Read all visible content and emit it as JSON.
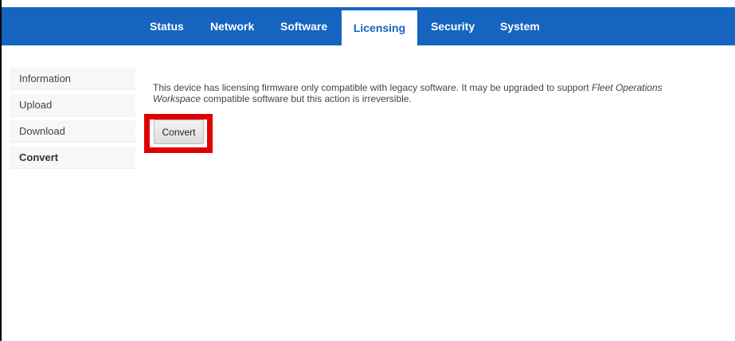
{
  "nav": {
    "tabs": [
      {
        "label": "Status"
      },
      {
        "label": "Network"
      },
      {
        "label": "Software"
      },
      {
        "label": "Licensing"
      },
      {
        "label": "Security"
      },
      {
        "label": "System"
      }
    ],
    "active_tab": "Licensing",
    "bar_color": "#1565c0"
  },
  "sidebar": {
    "items": [
      {
        "label": "Information"
      },
      {
        "label": "Upload"
      },
      {
        "label": "Download"
      },
      {
        "label": "Convert"
      }
    ],
    "active_item": "Convert"
  },
  "main": {
    "message_prefix": "This device has licensing firmware only compatible with legacy software. It may be upgraded to support ",
    "message_emphasis": "Fleet Operations Workspace",
    "message_suffix": " compatible software but this action is irreversible.",
    "convert_button_label": "Convert",
    "highlight_color": "#e00000"
  }
}
